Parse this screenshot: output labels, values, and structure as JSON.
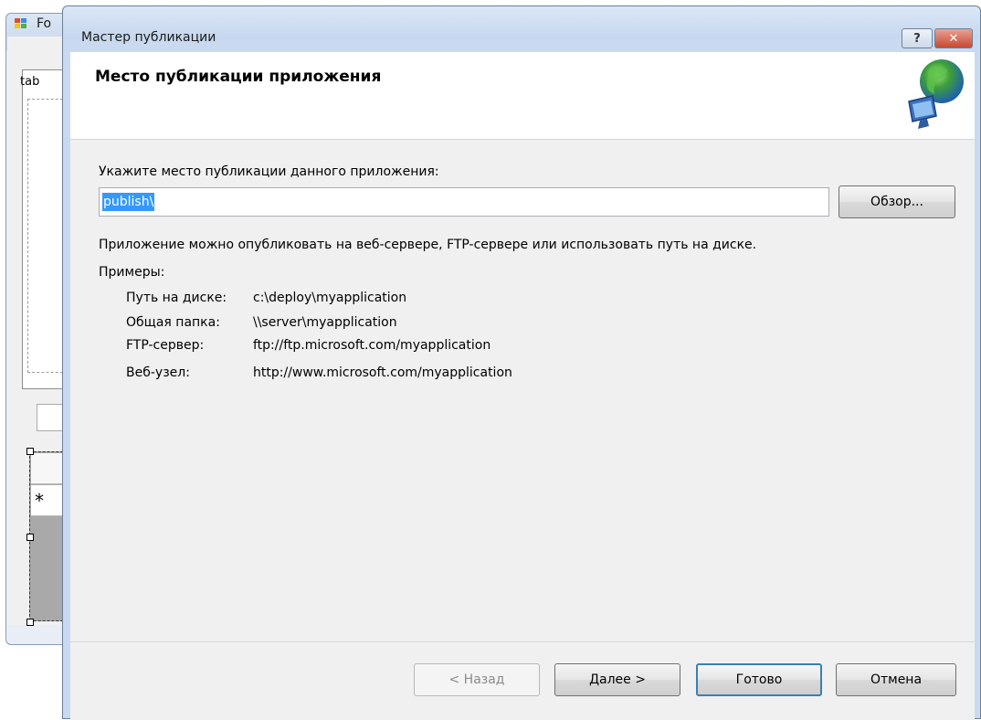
{
  "background_form": {
    "title": "Fo",
    "tab_label": "tab",
    "grid_new_row_marker": "*"
  },
  "dialog": {
    "title": "Мастер публикации",
    "help_glyph": "?",
    "close_glyph": "✕",
    "header_title": "Место публикации приложения",
    "prompt_label": "Укажите место публикации данного приложения:",
    "path_value": "publish\\",
    "browse_label": "Обзор...",
    "info_text": "Приложение можно опубликовать на веб-сервере, FTP-сервере или использовать путь на диске.",
    "examples_label": "Примеры:",
    "examples": [
      {
        "key": "Путь на диске:",
        "value": "c:\\deploy\\myapplication"
      },
      {
        "key": "Общая папка:",
        "value": "\\\\server\\myapplication"
      },
      {
        "key": "FTP-сервер:",
        "value": "ftp://ftp.microsoft.com/myapplication"
      },
      {
        "key": "Веб-узел:",
        "value": "http://www.microsoft.com/myapplication"
      }
    ],
    "buttons": {
      "back": "< Назад",
      "next": "Далее >",
      "finish": "Готово",
      "cancel": "Отмена"
    }
  },
  "icons": {
    "header": "globe-network-icon",
    "form": "form-icon"
  }
}
